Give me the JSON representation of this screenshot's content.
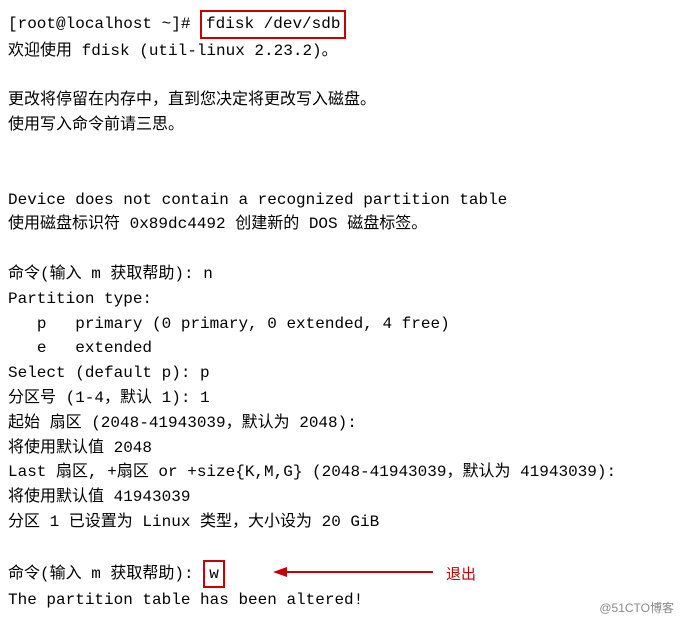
{
  "prompt": {
    "prefix": "[root@localhost ~]# ",
    "command": "fdisk /dev/sdb"
  },
  "lines": {
    "welcome": "欢迎使用 fdisk (util-linux 2.23.2)。",
    "changes_memory": "更改将停留在内存中，直到您决定将更改写入磁盘。",
    "think_twice": "使用写入命令前请三思。",
    "no_partition_table": "Device does not contain a recognized partition table",
    "new_dos_label": "使用磁盘标识符 0x89dc4492 创建新的 DOS 磁盘标签。",
    "cmd_prompt_n": "命令(输入 m 获取帮助): n",
    "partition_type": "Partition type:",
    "primary": "   p   primary (0 primary, 0 extended, 4 free)",
    "extended": "   e   extended",
    "select_default": "Select (default p): p",
    "part_num": "分区号 (1-4，默认 1): 1",
    "start_sector": "起始 扇区 (2048-41943039，默认为 2048):",
    "default_start": "将使用默认值 2048",
    "last_sector": "Last 扇区, +扇区 or +size{K,M,G} (2048-41943039，默认为 41943039):",
    "default_last": "将使用默认值 41943039",
    "partition_set": "分区 1 已设置为 Linux 类型，大小设为 20 GiB",
    "cmd_prompt_w_prefix": "命令(输入 m 获取帮助): ",
    "cmd_w": "w",
    "altered": "The partition table has been altered!"
  },
  "annotation": {
    "exit_label": "退出"
  },
  "watermark": "@51CTO博客"
}
